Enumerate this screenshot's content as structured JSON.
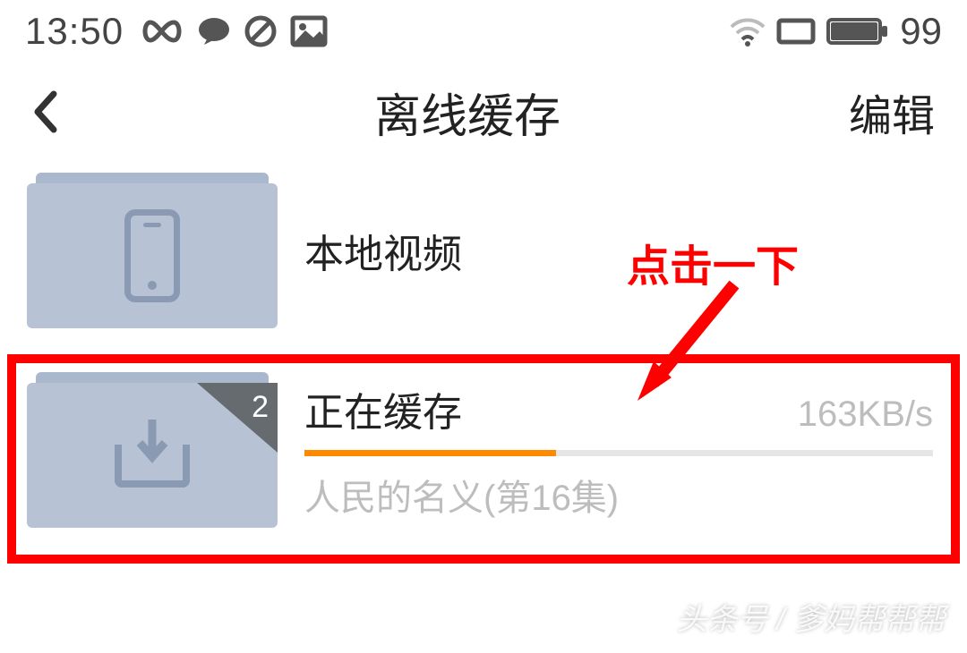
{
  "status": {
    "time": "13:50",
    "battery": "99"
  },
  "nav": {
    "title": "离线缓存",
    "edit": "编辑"
  },
  "items": {
    "local": {
      "title": "本地视频"
    },
    "caching": {
      "title": "正在缓存",
      "badge": "2",
      "speed": "163KB/s",
      "progress_percent": 40,
      "subtitle": "人民的名义(第16集)"
    }
  },
  "annotation": {
    "text": "点击一下"
  },
  "watermark": "头条号 / 爹妈帮帮帮"
}
